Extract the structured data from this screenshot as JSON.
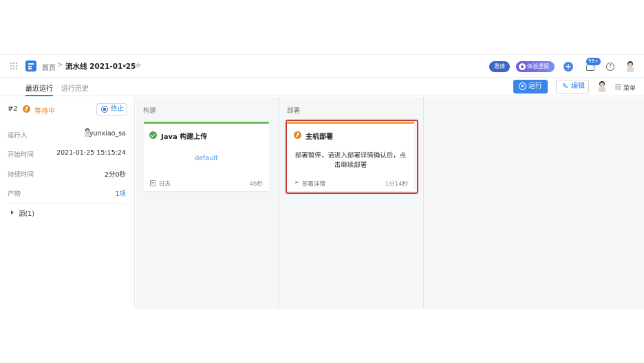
{
  "header": {
    "breadcrumb_home": "首页",
    "breadcrumb_sep": ">",
    "pipeline_name": "流水线 2021-01-25",
    "invite_label": "邀请",
    "experience_label": "体验透镜",
    "notification_badge": "99+",
    "help_label": "?"
  },
  "subbar": {
    "tabs": [
      {
        "label": "最近运行",
        "active": true
      },
      {
        "label": "运行历史",
        "active": false
      }
    ],
    "run_label": "运行",
    "edit_label": "编辑",
    "menu_label": "菜单"
  },
  "run": {
    "number": "#2",
    "status": "等待中",
    "stop_label": "终止",
    "details": [
      {
        "label": "运行人",
        "value": "yunxiao_sa"
      },
      {
        "label": "开始时间",
        "value": "2021-01-25 15:15:24"
      },
      {
        "label": "持续时间",
        "value": "2分0秒"
      },
      {
        "label": "产物",
        "value": "1项"
      }
    ],
    "source_label": "源(1)"
  },
  "stages": [
    {
      "title": "构建",
      "job": {
        "name": "Java 构建上传",
        "body": "default",
        "footer_label": "日志",
        "duration": "46秒",
        "status_color": "#4fa64a"
      }
    },
    {
      "title": "部署",
      "job": {
        "name": "主机部署",
        "body": "部署暂停，请进入部署详情确认后，点击继续部署",
        "footer_label": "部署详情",
        "duration": "1分14秒",
        "status_color": "#e08a2c"
      }
    }
  ],
  "colors": {
    "accent": "#2b7fe0",
    "waiting": "#e08a2c",
    "success": "#4fa64a",
    "highlight_frame": "#c8383a"
  }
}
